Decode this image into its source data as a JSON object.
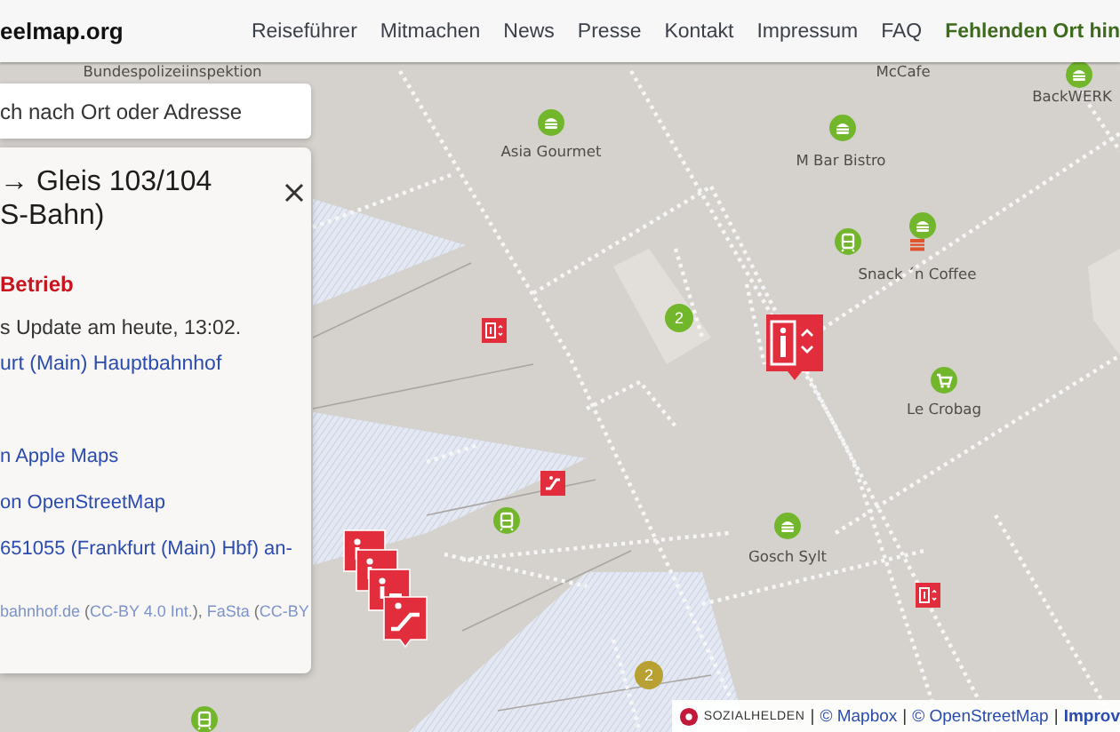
{
  "header": {
    "logo": "eelmap.org",
    "nav": [
      {
        "label": "Reiseführer",
        "kind": "link"
      },
      {
        "label": "Mitmachen",
        "kind": "link"
      },
      {
        "label": "News",
        "kind": "link"
      },
      {
        "label": "Presse",
        "kind": "link"
      },
      {
        "label": "Kontakt",
        "kind": "link"
      },
      {
        "label": "Impressum",
        "kind": "link"
      },
      {
        "label": "FAQ",
        "kind": "link"
      },
      {
        "label": "Fehlenden Ort hin",
        "kind": "cta"
      }
    ]
  },
  "search": {
    "placeholder": "ch nach Ort oder Adresse"
  },
  "panel": {
    "title": "→ Gleis 103/104 S-Bahn)",
    "status": "Betrieb",
    "update": "s Update am heute, 13:02.",
    "station_link": "urt (Main) Hauptbahnhof",
    "links": [
      "n Apple Maps",
      "on OpenStreetMap",
      "651055 (Frankfurt (Main) Hbf) an-"
    ],
    "credits": [
      {
        "kind": "link",
        "text": "bahnhof.de"
      },
      {
        "kind": "text",
        "text": " ("
      },
      {
        "kind": "link",
        "text": "CC-BY 4.0 Int."
      },
      {
        "kind": "text",
        "text": "), "
      },
      {
        "kind": "link",
        "text": "FaSta"
      },
      {
        "kind": "text",
        "text": " ("
      },
      {
        "kind": "link",
        "text": "CC-BY"
      }
    ]
  },
  "map": {
    "labels": [
      "Bundespolizeiinspektion",
      "McCafe",
      "BackWERK",
      "Asia Gourmet",
      "M Bar Bistro",
      "Snack ´n Coffee",
      "Le Crobag",
      "Gosch Sylt"
    ],
    "clusters": [
      {
        "count": "2",
        "color": "#72b62c"
      },
      {
        "count": "2",
        "color": "#b9a033"
      }
    ]
  },
  "attribution": {
    "items": [
      {
        "kind": "brand",
        "text": "SOZIALHELDEN"
      },
      {
        "kind": "sep",
        "text": "|"
      },
      {
        "kind": "link",
        "text": "© Mapbox"
      },
      {
        "kind": "sep",
        "text": "|"
      },
      {
        "kind": "link",
        "text": "© OpenStreetMap"
      },
      {
        "kind": "sep",
        "text": "|"
      },
      {
        "kind": "strong",
        "text": "Improv"
      }
    ]
  }
}
